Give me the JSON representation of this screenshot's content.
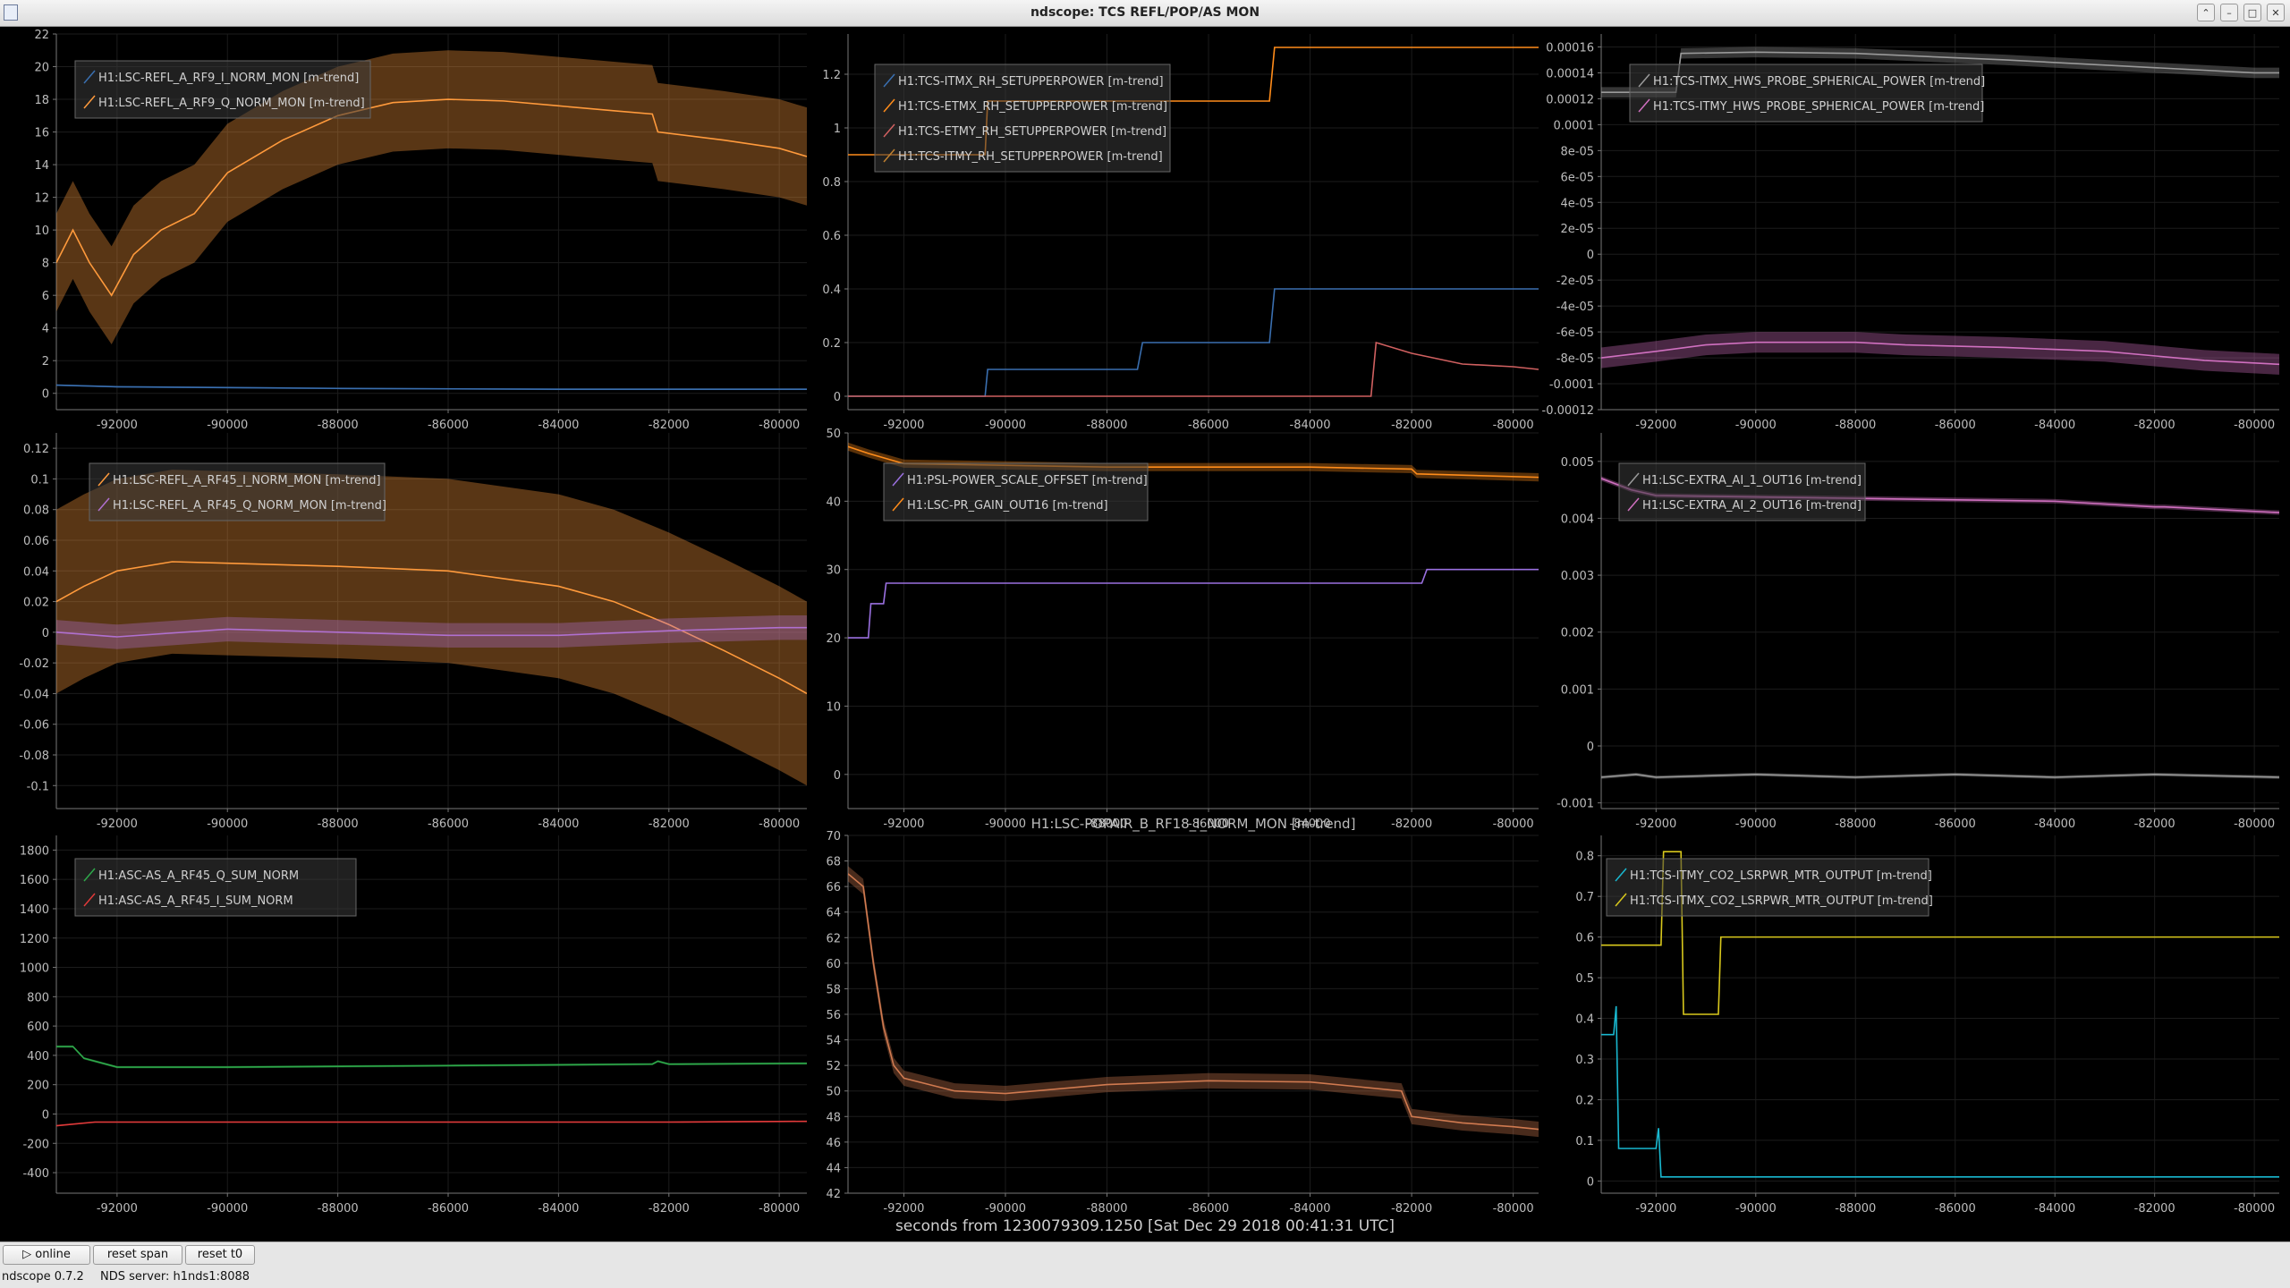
{
  "window": {
    "title": "ndscope: TCS REFL/POP/AS MON"
  },
  "xaxis": {
    "label": "seconds from 1230079309.1250 [Sat Dec 29 2018 00:41:31 UTC]",
    "range": [
      -93100,
      -79500
    ],
    "ticks": [
      -92000,
      -90000,
      -88000,
      -86000,
      -84000,
      -82000,
      -80000
    ]
  },
  "toolbar": {
    "online": "online",
    "reset_span": "reset span",
    "reset_t0": "reset t0"
  },
  "status": {
    "version": "ndscope 0.7.2",
    "server": "NDS server: h1nds1:8088"
  },
  "panels": [
    {
      "title": "",
      "ylim": [
        -1,
        22
      ],
      "yticks": [
        "0",
        "2",
        "4",
        "6",
        "8",
        "10",
        "12",
        "14",
        "16",
        "18",
        "20",
        "22"
      ],
      "yvals": [
        0,
        2,
        4,
        6,
        8,
        10,
        12,
        14,
        16,
        18,
        20,
        22
      ],
      "series": [
        {
          "name": "H1:LSC-REFL_A_RF9_I_NORM_MON [m-trend]",
          "color": "#3a6fb0",
          "band": 0.05,
          "points": [
            [
              -93100,
              0.5
            ],
            [
              -92000,
              0.4
            ],
            [
              -88000,
              0.3
            ],
            [
              -84000,
              0.25
            ],
            [
              -79500,
              0.25
            ]
          ]
        },
        {
          "name": "H1:LSC-REFL_A_RF9_Q_NORM_MON [m-trend]",
          "color": "#ff9a3c",
          "band": 3.0,
          "points": [
            [
              -93100,
              8
            ],
            [
              -92800,
              10
            ],
            [
              -92500,
              8
            ],
            [
              -92100,
              6
            ],
            [
              -91700,
              8.5
            ],
            [
              -91200,
              10
            ],
            [
              -90600,
              11
            ],
            [
              -90000,
              13.5
            ],
            [
              -89000,
              15.5
            ],
            [
              -88000,
              17
            ],
            [
              -87000,
              17.8
            ],
            [
              -86000,
              18
            ],
            [
              -85000,
              17.9
            ],
            [
              -84000,
              17.6
            ],
            [
              -83000,
              17.3
            ],
            [
              -82300,
              17.1
            ],
            [
              -82200,
              16
            ],
            [
              -81000,
              15.5
            ],
            [
              -80000,
              15
            ],
            [
              -79500,
              14.5
            ]
          ]
        }
      ]
    },
    {
      "title": "",
      "ylim": [
        -0.05,
        1.35
      ],
      "yticks": [
        "0",
        "0.2",
        "0.4",
        "0.6",
        "0.8",
        "1",
        "1.2"
      ],
      "yvals": [
        0,
        0.2,
        0.4,
        0.6,
        0.8,
        1,
        1.2
      ],
      "series": [
        {
          "name": "H1:TCS-ITMX_RH_SETUPPERPOWER [m-trend]",
          "color": "#3a6fb0",
          "band": 0,
          "points": [
            [
              -93100,
              0
            ],
            [
              -90400,
              0
            ],
            [
              -90350,
              0.1
            ],
            [
              -87400,
              0.1
            ],
            [
              -87300,
              0.2
            ],
            [
              -84800,
              0.2
            ],
            [
              -84700,
              0.4
            ],
            [
              -79500,
              0.4
            ]
          ]
        },
        {
          "name": "H1:TCS-ETMX_RH_SETUPPERPOWER [m-trend]",
          "color": "#ff8c1a",
          "band": 0,
          "points": [
            [
              -93100,
              0.9
            ],
            [
              -90400,
              0.9
            ],
            [
              -90350,
              1.1
            ],
            [
              -84800,
              1.1
            ],
            [
              -84700,
              1.3
            ],
            [
              -79500,
              1.3
            ]
          ]
        },
        {
          "name": "H1:TCS-ETMY_RH_SETUPPERPOWER [m-trend]",
          "color": "#d06060",
          "band": 0,
          "points": [
            [
              -93100,
              0
            ],
            [
              -82800,
              0
            ],
            [
              -82700,
              0.2
            ],
            [
              -82000,
              0.16
            ],
            [
              -81000,
              0.12
            ],
            [
              -80000,
              0.11
            ],
            [
              -79500,
              0.1
            ]
          ]
        },
        {
          "name": "H1:TCS-ITMY_RH_SETUPPERPOWER [m-trend]",
          "color": "#c08030",
          "band": 0,
          "points": []
        }
      ]
    },
    {
      "title": "",
      "ylim": [
        -0.00012,
        0.00017
      ],
      "yticks": [
        "0.00016",
        "0.00014",
        "0.00012",
        "0.0001",
        "8e-05",
        "6e-05",
        "4e-05",
        "2e-05",
        "0",
        "-2e-05",
        "-4e-05",
        "-6e-05",
        "-8e-05",
        "-0.0001",
        "-0.00012"
      ],
      "yvals": [
        0.00016,
        0.00014,
        0.00012,
        0.0001,
        8e-05,
        6e-05,
        4e-05,
        2e-05,
        0,
        -2e-05,
        -4e-05,
        -6e-05,
        -8e-05,
        -0.0001,
        -0.00012
      ],
      "series": [
        {
          "name": "H1:TCS-ITMX_HWS_PROBE_SPHERICAL_POWER [m-trend]",
          "color": "#9a9a9a",
          "band": 4e-06,
          "points": [
            [
              -93100,
              0.000125
            ],
            [
              -91600,
              0.000125
            ],
            [
              -91500,
              0.000155
            ],
            [
              -90000,
              0.000156
            ],
            [
              -88000,
              0.000155
            ],
            [
              -85000,
              0.00015
            ],
            [
              -82000,
              0.000144
            ],
            [
              -80000,
              0.00014
            ],
            [
              -79500,
              0.00014
            ]
          ]
        },
        {
          "name": "H1:TCS-ITMY_HWS_PROBE_SPHERICAL_POWER [m-trend]",
          "color": "#d070c0",
          "band": 8e-06,
          "points": [
            [
              -93100,
              -8e-05
            ],
            [
              -92000,
              -7.5e-05
            ],
            [
              -91000,
              -7e-05
            ],
            [
              -90000,
              -6.8e-05
            ],
            [
              -88000,
              -6.8e-05
            ],
            [
              -87000,
              -7e-05
            ],
            [
              -85000,
              -7.2e-05
            ],
            [
              -83000,
              -7.5e-05
            ],
            [
              -81000,
              -8.2e-05
            ],
            [
              -79500,
              -8.5e-05
            ]
          ]
        }
      ]
    },
    {
      "title": "",
      "ylim": [
        -0.115,
        0.13
      ],
      "yticks": [
        "0.12",
        "0.1",
        "0.08",
        "0.06",
        "0.04",
        "0.02",
        "0",
        "-0.02",
        "-0.04",
        "-0.06",
        "-0.08",
        "-0.1"
      ],
      "yvals": [
        0.12,
        0.1,
        0.08,
        0.06,
        0.04,
        0.02,
        0,
        -0.02,
        -0.04,
        -0.06,
        -0.08,
        -0.1
      ],
      "series": [
        {
          "name": "H1:LSC-REFL_A_RF45_I_NORM_MON [m-trend]",
          "color": "#ff9a3c",
          "band": 0.06,
          "points": [
            [
              -93100,
              0.02
            ],
            [
              -92600,
              0.03
            ],
            [
              -92000,
              0.04
            ],
            [
              -91000,
              0.046
            ],
            [
              -90000,
              0.045
            ],
            [
              -88000,
              0.043
            ],
            [
              -86000,
              0.04
            ],
            [
              -84000,
              0.03
            ],
            [
              -83000,
              0.02
            ],
            [
              -82000,
              0.005
            ],
            [
              -81000,
              -0.012
            ],
            [
              -80000,
              -0.03
            ],
            [
              -79500,
              -0.04
            ]
          ]
        },
        {
          "name": "H1:LSC-REFL_A_RF45_Q_NORM_MON [m-trend]",
          "color": "#b070d0",
          "band": 0.008,
          "points": [
            [
              -93100,
              0
            ],
            [
              -92000,
              -0.003
            ],
            [
              -90000,
              0.002
            ],
            [
              -88000,
              0
            ],
            [
              -86000,
              -0.002
            ],
            [
              -84000,
              -0.002
            ],
            [
              -82000,
              0.001
            ],
            [
              -80000,
              0.003
            ],
            [
              -79500,
              0.003
            ]
          ]
        }
      ]
    },
    {
      "title": "",
      "ylim": [
        -5,
        50
      ],
      "yticks": [
        "50",
        "40",
        "30",
        "20",
        "10",
        "0"
      ],
      "yvals": [
        50,
        40,
        30,
        20,
        10,
        0
      ],
      "series": [
        {
          "name": "H1:PSL-POWER_SCALE_OFFSET [m-trend]",
          "color": "#9a70e0",
          "band": 0,
          "points": [
            [
              -93100,
              20
            ],
            [
              -92700,
              20
            ],
            [
              -92650,
              25
            ],
            [
              -92400,
              25
            ],
            [
              -92350,
              28
            ],
            [
              -81800,
              28
            ],
            [
              -81700,
              30
            ],
            [
              -79500,
              30
            ]
          ]
        },
        {
          "name": "H1:LSC-PR_GAIN_OUT16 [m-trend]",
          "color": "#ff8c1a",
          "band": 0.6,
          "points": [
            [
              -93100,
              48
            ],
            [
              -92700,
              47
            ],
            [
              -92000,
              45.5
            ],
            [
              -88000,
              45
            ],
            [
              -84000,
              45
            ],
            [
              -82000,
              44.7
            ],
            [
              -81900,
              44
            ],
            [
              -79500,
              43.5
            ]
          ]
        }
      ]
    },
    {
      "title": "",
      "ylim": [
        -0.0011,
        0.0055
      ],
      "yticks": [
        "0.005",
        "0.004",
        "0.003",
        "0.002",
        "0.001",
        "0",
        "-0.001"
      ],
      "yvals": [
        0.005,
        0.004,
        0.003,
        0.002,
        0.001,
        0,
        -0.001
      ],
      "series": [
        {
          "name": "H1:LSC-EXTRA_AI_1_OUT16 [m-trend]",
          "color": "#9a9a9a",
          "band": 3e-05,
          "points": [
            [
              -93100,
              -0.00055
            ],
            [
              -92400,
              -0.0005
            ],
            [
              -92000,
              -0.00055
            ],
            [
              -90000,
              -0.0005
            ],
            [
              -88000,
              -0.00055
            ],
            [
              -86000,
              -0.0005
            ],
            [
              -84000,
              -0.00055
            ],
            [
              -82000,
              -0.0005
            ],
            [
              -79500,
              -0.00055
            ]
          ]
        },
        {
          "name": "H1:LSC-EXTRA_AI_2_OUT16 [m-trend]",
          "color": "#d070c0",
          "band": 4e-05,
          "points": [
            [
              -93100,
              0.0047
            ],
            [
              -92500,
              0.0045
            ],
            [
              -92000,
              0.0044
            ],
            [
              -88000,
              0.00435
            ],
            [
              -84000,
              0.0043
            ],
            [
              -82000,
              0.0042
            ],
            [
              -81800,
              0.0042
            ],
            [
              -79500,
              0.0041
            ]
          ]
        }
      ]
    },
    {
      "title": "",
      "ylim": [
        -540,
        1900
      ],
      "yticks": [
        "1800",
        "1600",
        "1400",
        "1200",
        "1000",
        "800",
        "600",
        "400",
        "200",
        "0",
        "-200",
        "-400"
      ],
      "yvals": [
        1800,
        1600,
        1400,
        1200,
        1000,
        800,
        600,
        400,
        200,
        0,
        -200,
        -400
      ],
      "series": [
        {
          "name": "H1:ASC-AS_A_RF45_Q_SUM_NORM",
          "color": "#2ea84a",
          "band": 8,
          "points": [
            [
              -93100,
              460
            ],
            [
              -92800,
              460
            ],
            [
              -92600,
              380
            ],
            [
              -92000,
              320
            ],
            [
              -90000,
              320
            ],
            [
              -86000,
              330
            ],
            [
              -82300,
              340
            ],
            [
              -82200,
              360
            ],
            [
              -82000,
              340
            ],
            [
              -79500,
              345
            ]
          ]
        },
        {
          "name": "H1:ASC-AS_A_RF45_I_SUM_NORM",
          "color": "#e03a3a",
          "band": 5,
          "points": [
            [
              -93100,
              -80
            ],
            [
              -92400,
              -55
            ],
            [
              -90000,
              -55
            ],
            [
              -86000,
              -55
            ],
            [
              -82000,
              -55
            ],
            [
              -79500,
              -50
            ]
          ]
        }
      ]
    },
    {
      "title": "H1:LSC-POPAIR_B_RF18_I_NORM_MON [m-trend]",
      "ylim": [
        42,
        70
      ],
      "yticks": [
        "70",
        "68",
        "66",
        "64",
        "62",
        "60",
        "58",
        "56",
        "54",
        "52",
        "50",
        "48",
        "46",
        "44",
        "42"
      ],
      "yvals": [
        70,
        68,
        66,
        64,
        62,
        60,
        58,
        56,
        54,
        52,
        50,
        48,
        46,
        44,
        42
      ],
      "series": [
        {
          "name": "",
          "color": "#d07a50",
          "band": 0.6,
          "points": [
            [
              -93100,
              67
            ],
            [
              -92800,
              66
            ],
            [
              -92600,
              60
            ],
            [
              -92400,
              55
            ],
            [
              -92200,
              52
            ],
            [
              -92000,
              51
            ],
            [
              -91000,
              50
            ],
            [
              -90000,
              49.8
            ],
            [
              -88000,
              50.5
            ],
            [
              -86000,
              50.8
            ],
            [
              -84000,
              50.7
            ],
            [
              -82200,
              50
            ],
            [
              -82000,
              48
            ],
            [
              -81000,
              47.5
            ],
            [
              -80000,
              47.2
            ],
            [
              -79500,
              47
            ]
          ]
        }
      ]
    },
    {
      "title": "",
      "ylim": [
        -0.03,
        0.85
      ],
      "yticks": [
        "0.8",
        "0.7",
        "0.6",
        "0.5",
        "0.4",
        "0.3",
        "0.2",
        "0.1",
        "0"
      ],
      "yvals": [
        0.8,
        0.7,
        0.6,
        0.5,
        0.4,
        0.3,
        0.2,
        0.1,
        0
      ],
      "series": [
        {
          "name": "H1:TCS-ITMY_CO2_LSRPWR_MTR_OUTPUT [m-trend]",
          "color": "#19b8d0",
          "band": 0,
          "points": [
            [
              -93100,
              0.36
            ],
            [
              -92850,
              0.36
            ],
            [
              -92800,
              0.43
            ],
            [
              -92750,
              0.08
            ],
            [
              -92000,
              0.08
            ],
            [
              -91950,
              0.13
            ],
            [
              -91900,
              0.01
            ],
            [
              -79500,
              0.01
            ]
          ]
        },
        {
          "name": "H1:TCS-ITMX_CO2_LSRPWR_MTR_OUTPUT [m-trend]",
          "color": "#d8c81c",
          "band": 0,
          "points": [
            [
              -93100,
              0.58
            ],
            [
              -91900,
              0.58
            ],
            [
              -91850,
              0.81
            ],
            [
              -91500,
              0.81
            ],
            [
              -91450,
              0.41
            ],
            [
              -90750,
              0.41
            ],
            [
              -90700,
              0.6
            ],
            [
              -79500,
              0.6
            ]
          ]
        }
      ]
    }
  ]
}
